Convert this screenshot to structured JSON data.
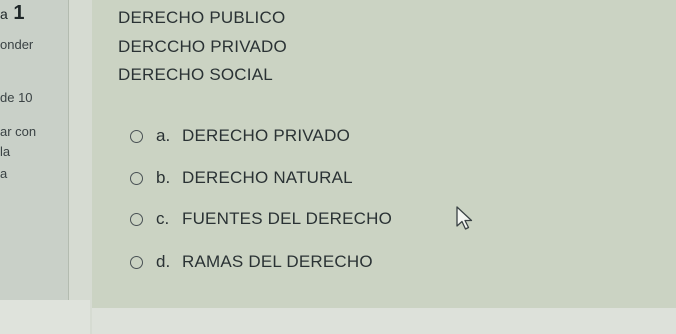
{
  "sidebar": {
    "question_prefix": "a",
    "question_number": "1",
    "status": "onder",
    "score": "de 10",
    "flag_line1": "ar con",
    "flag_line2": "la",
    "flag_line3": "a"
  },
  "question": {
    "lines": [
      "DERECHO PUBLICO",
      "DERCCHO PRIVADO",
      "DERECHO SOCIAL"
    ]
  },
  "options": [
    {
      "letter": "a.",
      "text": "DERECHO PRIVADO"
    },
    {
      "letter": "b.",
      "text": "DERECHO NATURAL"
    },
    {
      "letter": "c.",
      "text": "FUENTES DEL DERECHO"
    },
    {
      "letter": "d.",
      "text": "RAMAS DEL DERECHO"
    }
  ],
  "icons": {
    "cursor": "mouse-pointer-icon",
    "radio": "radio-button-icon"
  }
}
